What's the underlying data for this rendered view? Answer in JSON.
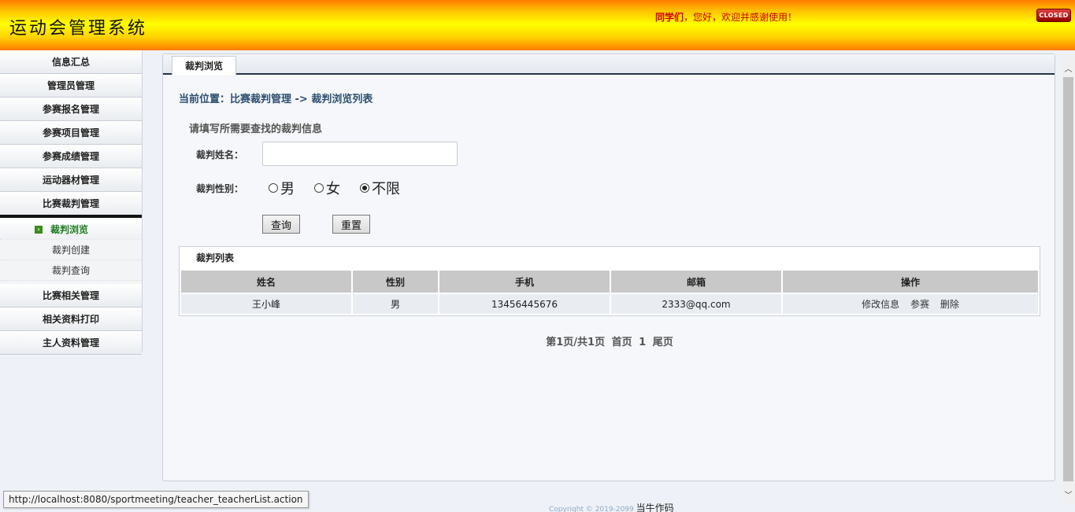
{
  "header": {
    "title": "运动会管理系统",
    "welcome_prefix": "同学们",
    "welcome_text": "，您好，欢迎并感谢使用！",
    "close_label": "CLOSED"
  },
  "sidebar": {
    "items": [
      {
        "label": "信息汇总"
      },
      {
        "label": "管理员管理"
      },
      {
        "label": "参赛报名管理"
      },
      {
        "label": "参赛项目管理"
      },
      {
        "label": "参赛成绩管理"
      },
      {
        "label": "运动器材管理"
      },
      {
        "label": "比赛裁判管理"
      },
      {
        "label": "比赛相关管理"
      },
      {
        "label": "相关资料打印"
      },
      {
        "label": "主人资料管理"
      }
    ],
    "submenu": [
      {
        "label": "裁判浏览",
        "selected": true
      },
      {
        "label": "裁判创建"
      },
      {
        "label": "裁判查询"
      }
    ]
  },
  "main": {
    "tab_label": "裁判浏览",
    "breadcrumb": "当前位置：比赛裁判管理 -> 裁判浏览列表",
    "search_title": "请填写所需要查找的裁判信息",
    "name_label": "裁判姓名：",
    "name_value": "",
    "gender_label": "裁判性别：",
    "gender_options": [
      "男",
      "女",
      "不限"
    ],
    "gender_selected": "不限",
    "query_button": "查询",
    "reset_button": "重置",
    "table": {
      "caption": "裁判列表",
      "columns": [
        "姓名",
        "性别",
        "手机",
        "邮箱",
        "操作"
      ],
      "rows": [
        {
          "name": "王小峰",
          "gender": "男",
          "phone": "13456445676",
          "email": "2333@qq.com",
          "actions": [
            "修改信息",
            "参赛",
            "删除"
          ]
        }
      ]
    },
    "pager": "第1页/共1页  首页  1  尾页"
  },
  "footer": {
    "copyright": "Copyright © 2019-2099",
    "author": "当牛作码"
  },
  "statusbar": {
    "url": "http://localhost:8080/sportmeeting/teacher_teacherList.action"
  }
}
